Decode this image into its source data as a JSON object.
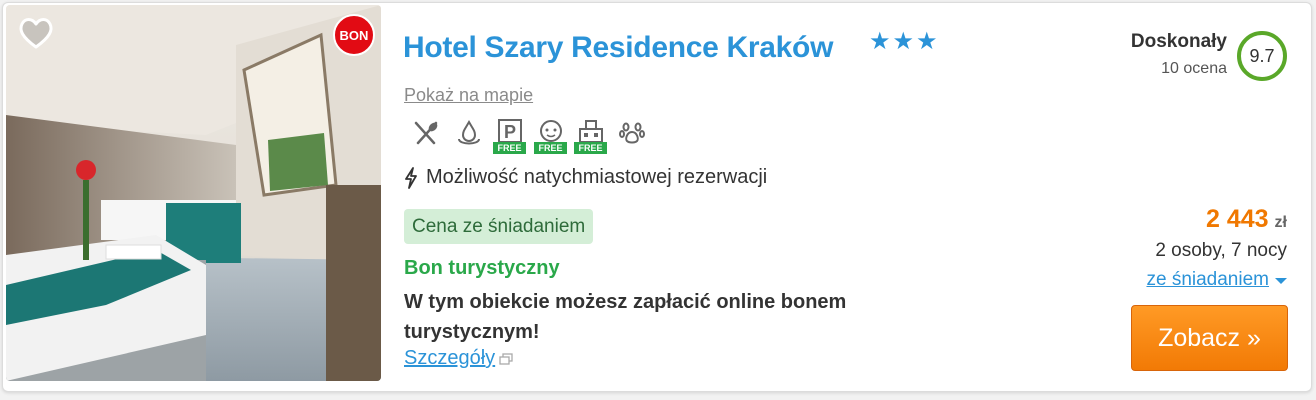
{
  "hotel": {
    "name": "Hotel Szary Residence Kraków",
    "stars": "★★★",
    "map_link": "Pokaż na mapie",
    "instant_booking": "Możliwość natychmiastowej rezerwacji"
  },
  "badges": {
    "bon": "BON"
  },
  "amenities": [
    {
      "icon": "restaurant-icon",
      "free": ""
    },
    {
      "icon": "water-drop-icon",
      "free": ""
    },
    {
      "icon": "parking-icon",
      "free": "FREE"
    },
    {
      "icon": "kids-icon",
      "free": "FREE"
    },
    {
      "icon": "building-icon",
      "free": "FREE"
    },
    {
      "icon": "paw-icon",
      "free": ""
    }
  ],
  "tags": {
    "breakfast": "Cena ze śniadaniem"
  },
  "bon_turystyczny": {
    "title": "Bon turystyczny",
    "description": "W tym obiekcie możesz zapłacić online bonem turystycznym!",
    "details_link": "Szczegóły"
  },
  "rating": {
    "label": "Doskonały",
    "count": "10 ocena",
    "score": "9.7",
    "color": "#5aa829"
  },
  "price": {
    "amount": "2 443",
    "currency": "zł",
    "persons": "2 osoby, 7 nocy",
    "board": "ze śniadaniem"
  },
  "cta": {
    "label": "Zobacz »"
  },
  "colors": {
    "accent": "#2b93d8",
    "price": "#f07800",
    "cta": "#f27a05",
    "green": "#2aa84a",
    "bon_red": "#e20b14"
  }
}
